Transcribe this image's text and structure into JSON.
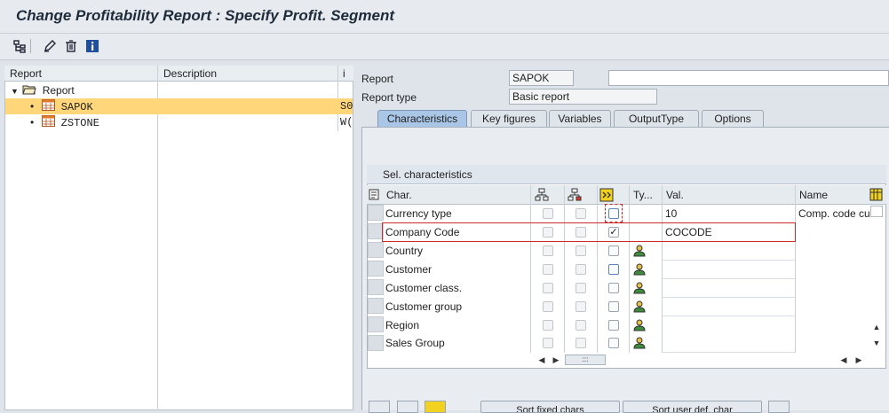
{
  "window": {
    "title": "Change Profitability Report  : Specify Profit. Segment"
  },
  "toolbar": {
    "icons": [
      "hierarchy-icon",
      "pencil-icon",
      "trash-icon",
      "info-icon"
    ]
  },
  "tree": {
    "headers": {
      "report": "Report",
      "description": "Description",
      "extra": "і"
    },
    "root_label": "Report",
    "items": [
      {
        "name": "SAPOK",
        "extra": "S0",
        "selected": true
      },
      {
        "name": "ZSTONE",
        "extra": "W("
      }
    ]
  },
  "form": {
    "report_label": "Report",
    "report_value": "SAPOK",
    "report_desc": "",
    "type_label": "Report type",
    "type_value": "Basic report"
  },
  "tabs": [
    "Characteristics",
    "Key figures",
    "Variables",
    "OutputType",
    "Options"
  ],
  "grid": {
    "title": "Sel. characteristics",
    "headers": {
      "char": "Char.",
      "ty": "Ty...",
      "val": "Val.",
      "name": "Name"
    },
    "rows": [
      {
        "char": "Currency type",
        "val": "10",
        "name": "Comp. code cu",
        "checked": false
      },
      {
        "char": "Company Code",
        "val": "COCODE",
        "name": "",
        "checked": true
      },
      {
        "char": "Country",
        "val": "",
        "name": "",
        "checked": false
      },
      {
        "char": "Customer",
        "val": "",
        "name": "",
        "checked": false
      },
      {
        "char": "Customer class.",
        "val": "",
        "name": "",
        "checked": false
      },
      {
        "char": "Customer group",
        "val": "",
        "name": "",
        "checked": false
      },
      {
        "char": "Region",
        "val": "",
        "name": "",
        "checked": false
      },
      {
        "char": "Sales Group",
        "val": "",
        "name": "",
        "checked": false
      }
    ]
  },
  "buttons": {
    "sort_fixed": "Sort fixed chars",
    "sort_user": "Sort user def. char"
  },
  "colors": {
    "selected_row": "#ffd67a",
    "active_tab": "#a9c6e6",
    "highlight_border": "#cc2a2a"
  }
}
